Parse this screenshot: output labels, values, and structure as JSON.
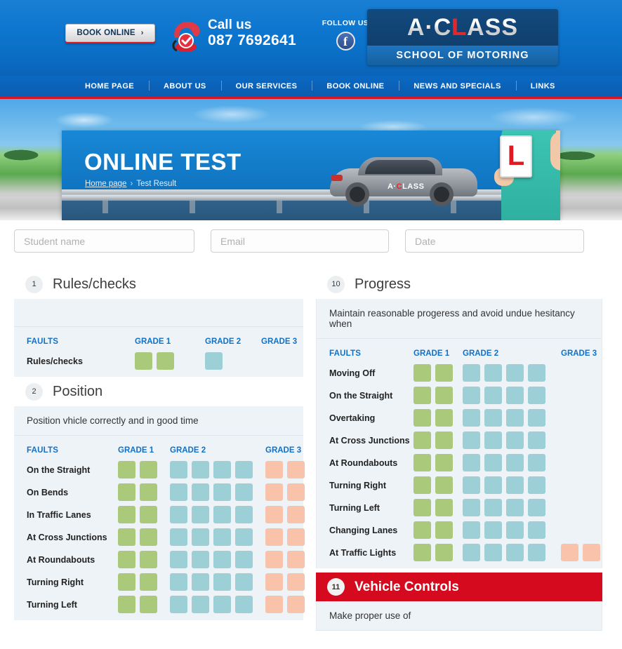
{
  "header": {
    "book_online_label": "BOOK ONLINE",
    "book_online_chevron": "›",
    "call_us_label": "Call us",
    "phone": "087 7692641",
    "follow_us_label": "FOLLOW US",
    "facebook_glyph": "f",
    "logo": {
      "part_a": "A·C",
      "part_red": "L",
      "part_b": "ASS",
      "tagline": "SCHOOL OF MOTORING"
    }
  },
  "nav": {
    "items": [
      {
        "label": "HOME PAGE"
      },
      {
        "label": "ABOUT US"
      },
      {
        "label": "OUR SERVICES"
      },
      {
        "label": "BOOK ONLINE"
      },
      {
        "label": "NEWS AND SPECIALS"
      },
      {
        "label": "LINKS"
      }
    ]
  },
  "hero": {
    "title": "ONLINE TEST",
    "breadcrumb_home": "Home page",
    "breadcrumb_sep": "›",
    "breadcrumb_current": "Test Result",
    "car_logo_a": "A·",
    "car_logo_red": "C",
    "car_logo_b": "LASS",
    "l_plate": "L"
  },
  "form": {
    "student_name_placeholder": "Student name",
    "email_placeholder": "Email",
    "date_placeholder": "Date",
    "student_name_value": "",
    "email_value": "",
    "date_value": ""
  },
  "table_headers": {
    "faults": "FAULTS",
    "grade1": "GRADE 1",
    "grade2": "GRADE 2",
    "grade3": "GRADE 3"
  },
  "colors": {
    "grade1": "#aac97a",
    "grade2": "#9dd0d6",
    "grade3": "#f8c3aa",
    "accent_red": "#d60a1e",
    "link_blue": "#1071c9",
    "panel_bg": "#eef3f7",
    "brand_blue": "#0b69c2"
  },
  "left_column": {
    "sections": [
      {
        "number": "1",
        "title": "Rules/checks",
        "description": "",
        "rows": [
          {
            "label": "Rules/checks",
            "grade1": 2,
            "grade2": 1,
            "grade3": 0
          }
        ]
      },
      {
        "number": "2",
        "title": "Position",
        "description": "Position vhicle correctly and in good time",
        "rows": [
          {
            "label": "On the Straight",
            "grade1": 2,
            "grade2": 4,
            "grade3": 2
          },
          {
            "label": "On Bends",
            "grade1": 2,
            "grade2": 4,
            "grade3": 2
          },
          {
            "label": "In Traffic Lanes",
            "grade1": 2,
            "grade2": 4,
            "grade3": 2
          },
          {
            "label": "At Cross Junctions",
            "grade1": 2,
            "grade2": 4,
            "grade3": 2
          },
          {
            "label": "At Roundabouts",
            "grade1": 2,
            "grade2": 4,
            "grade3": 2
          },
          {
            "label": "Turning Right",
            "grade1": 2,
            "grade2": 4,
            "grade3": 2
          },
          {
            "label": "Turning Left",
            "grade1": 2,
            "grade2": 4,
            "grade3": 2
          }
        ]
      }
    ]
  },
  "right_column": {
    "sections": [
      {
        "number": "10",
        "title": "Progress",
        "description": "Maintain reasonable progeress and avoid undue hesitancy when",
        "rows": [
          {
            "label": "Moving Off",
            "grade1": 2,
            "grade2": 4,
            "grade3": 0
          },
          {
            "label": "On the Straight",
            "grade1": 2,
            "grade2": 4,
            "grade3": 0
          },
          {
            "label": "Overtaking",
            "grade1": 2,
            "grade2": 4,
            "grade3": 0
          },
          {
            "label": "At Cross Junctions",
            "grade1": 2,
            "grade2": 4,
            "grade3": 0
          },
          {
            "label": "At Roundabouts",
            "grade1": 2,
            "grade2": 4,
            "grade3": 0
          },
          {
            "label": "Turning Right",
            "grade1": 2,
            "grade2": 4,
            "grade3": 0
          },
          {
            "label": "Turning Left",
            "grade1": 2,
            "grade2": 4,
            "grade3": 0
          },
          {
            "label": "Changing Lanes",
            "grade1": 2,
            "grade2": 4,
            "grade3": 0
          },
          {
            "label": "At Traffic Lights",
            "grade1": 2,
            "grade2": 4,
            "grade3": 2
          }
        ]
      },
      {
        "number": "11",
        "title": "Vehicle Controls",
        "highlight": true,
        "description": "Make proper use of",
        "rows": []
      }
    ]
  }
}
